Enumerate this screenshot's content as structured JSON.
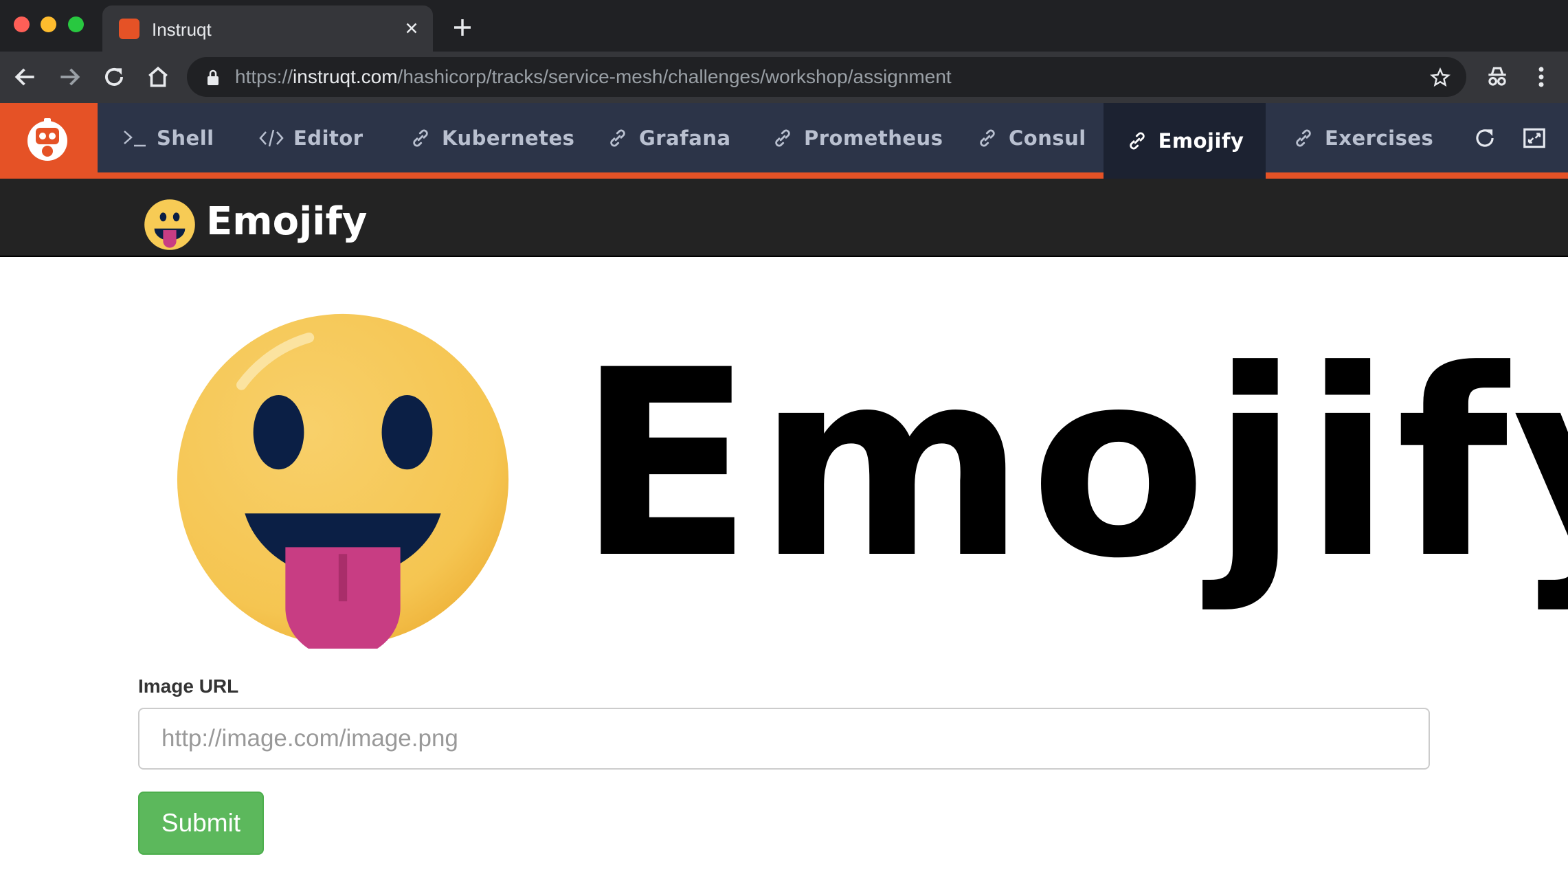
{
  "browser": {
    "tab_title": "Instruqt",
    "url_scheme": "https://",
    "url_host": "instruqt.com",
    "url_path": "/hashicorp/tracks/service-mesh/challenges/workshop/assignment",
    "icons": [
      "close-icon",
      "plus-icon",
      "back-icon",
      "forward-icon",
      "reload-icon",
      "home-icon",
      "lock-icon",
      "star-icon",
      "incognito-icon",
      "more-icon"
    ]
  },
  "instruqt": {
    "tabs": [
      {
        "label": "Shell",
        "icon": "terminal-icon"
      },
      {
        "label": "Editor",
        "icon": "code-icon"
      },
      {
        "label": "Kubernetes",
        "icon": "link-icon"
      },
      {
        "label": "Grafana",
        "icon": "link-icon"
      },
      {
        "label": "Prometheus",
        "icon": "link-icon"
      },
      {
        "label": "Consul",
        "icon": "link-icon"
      },
      {
        "label": "Emojify",
        "icon": "link-icon"
      },
      {
        "label": "Exercises",
        "icon": "link-icon"
      }
    ],
    "active_tab": "Emojify",
    "accent_color": "#e55226",
    "bar_color": "#2c3448"
  },
  "app": {
    "header_title": "Emojify",
    "hero_title": "Emojify",
    "form": {
      "label": "Image URL",
      "placeholder": "http://image.com/image.png",
      "value": "",
      "submit_label": "Submit"
    },
    "submit_color": "#5cb85c"
  }
}
